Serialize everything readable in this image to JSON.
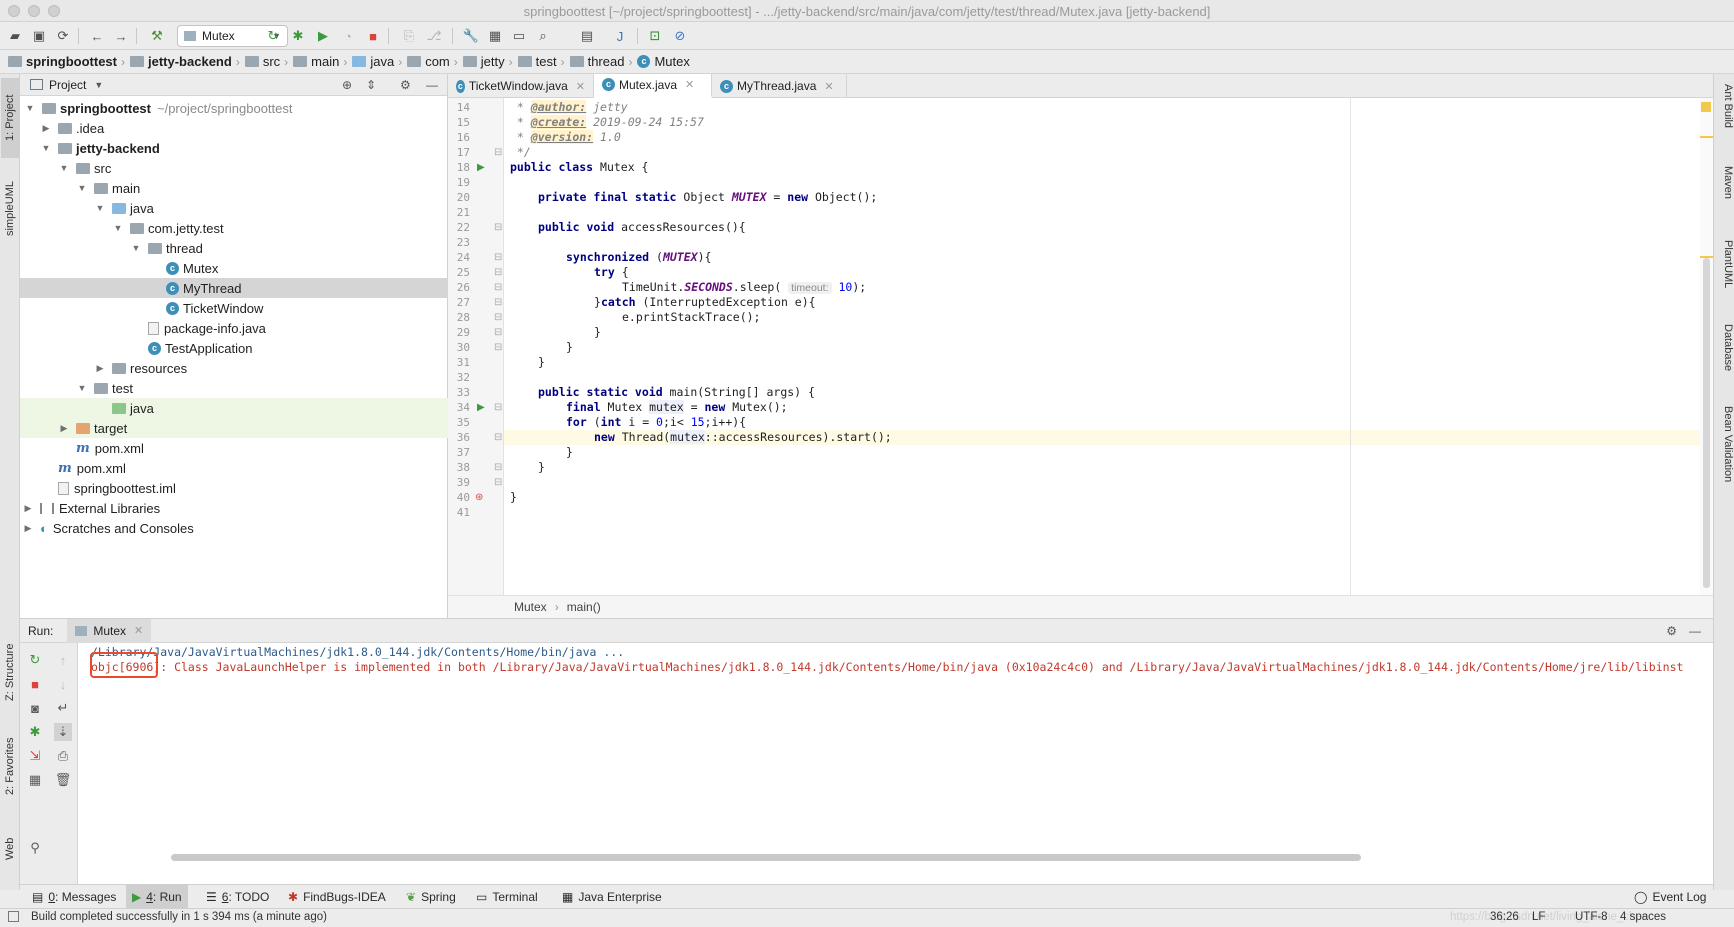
{
  "window": {
    "title": "springboottest [~/project/springboottest] - .../jetty-backend/src/main/java/com/jetty/test/thread/Mutex.java [jetty-backend]"
  },
  "toolbar": {
    "run_config": "Mutex"
  },
  "breadcrumbs": [
    "springboottest",
    "jetty-backend",
    "src",
    "main",
    "java",
    "com",
    "jetty",
    "test",
    "thread",
    "Mutex"
  ],
  "left_strip": {
    "tabs": [
      "1: Project",
      "simpleUML",
      "Z: Structure",
      "2: Favorites",
      "Web"
    ]
  },
  "right_strip": {
    "tabs": [
      "Ant Build",
      "Maven",
      "PlantUML",
      "Database",
      "Bean Validation"
    ]
  },
  "project": {
    "header": "Project",
    "tree": [
      {
        "label": "springboottest",
        "extra": "~/project/springboottest",
        "bold": true
      },
      {
        "label": ".idea"
      },
      {
        "label": "jetty-backend",
        "bold": true
      },
      {
        "label": "src"
      },
      {
        "label": "main"
      },
      {
        "label": "java"
      },
      {
        "label": "com.jetty.test"
      },
      {
        "label": "thread"
      },
      {
        "label": "Mutex"
      },
      {
        "label": "MyThread"
      },
      {
        "label": "TicketWindow"
      },
      {
        "label": "package-info.java"
      },
      {
        "label": "TestApplication"
      },
      {
        "label": "resources"
      },
      {
        "label": "test"
      },
      {
        "label": "java"
      },
      {
        "label": "target"
      },
      {
        "label": "pom.xml"
      },
      {
        "label": "pom.xml"
      },
      {
        "label": "springboottest.iml"
      },
      {
        "label": "External Libraries"
      },
      {
        "label": "Scratches and Consoles"
      }
    ]
  },
  "editor": {
    "tabs": [
      "TicketWindow.java",
      "Mutex.java",
      "MyThread.java"
    ],
    "active_tab": "Mutex.java",
    "line_numbers": [
      "14",
      "15",
      "16",
      "17",
      "18",
      "19",
      "20",
      "21",
      "22",
      "23",
      "24",
      "25",
      "26",
      "27",
      "28",
      "29",
      "30",
      "31",
      "32",
      "33",
      "34",
      "35",
      "36",
      "37",
      "38",
      "39",
      "40",
      "41"
    ],
    "code": {
      "l14_tag": "@author:",
      "l14_val": " jetty",
      "l15_tag": "@create:",
      "l15_val": " 2019-09-24 15:57",
      "l16_tag": "@version:",
      "l16_val": " 1.0",
      "l17": " */",
      "l18_kw": "public class",
      "l18_rest": " Mutex {",
      "l20_kw": "private final static",
      "l20_a": " Object ",
      "l20_st": "MUTEX",
      "l20_b": " = ",
      "l20_kw2": "new",
      "l20_c": " Object();",
      "l22_kw": "public void",
      "l22_rest": " accessResources(){",
      "l24_kw": "synchronized",
      "l24_a": " (",
      "l24_st": "MUTEX",
      "l24_b": "){",
      "l25_kw": "try",
      "l25_rest": " {",
      "l26_a": "TimeUnit.",
      "l26_st": "SECONDS",
      "l26_b": ".sleep( ",
      "l26_hint": "timeout:",
      "l26_num": "10",
      "l26_c": ");",
      "l27_a": "}",
      "l27_kw": "catch",
      "l27_b": " (InterruptedException e){",
      "l28": "e.printStackTrace();",
      "l29": "}",
      "l30": "}",
      "l31": "}",
      "l33_kw": "public static void",
      "l33_rest": " main(String[] args) {",
      "l34_kw": "final",
      "l34_a": " Mutex ",
      "l34_ref": "mutex",
      "l34_b": " = ",
      "l34_kw2": "new",
      "l34_c": " Mutex();",
      "l35_kw": "for",
      "l35_a": " (",
      "l35_kw2": "int",
      "l35_b": " i = ",
      "l35_num": "0",
      "l35_c": ";i< ",
      "l35_num2": "15",
      "l35_d": ";i++){",
      "l36_kw": "new",
      "l36_a": " Thread(",
      "l36_ref": "mutex",
      "l36_b": "::accessResources).start();",
      "l37": "}",
      "l38": "}",
      "l40": "}"
    },
    "crumbs": [
      "Mutex",
      "main()"
    ]
  },
  "run_panel": {
    "label": "Run:",
    "tab": "Mutex",
    "console_lines": [
      "/Library/Java/JavaVirtualMachines/jdk1.8.0_144.jdk/Contents/Home/bin/java ...",
      "objc[6906]: Class JavaLaunchHelper is implemented in both /Library/Java/JavaVirtualMachines/jdk1.8.0_144.jdk/Contents/Home/bin/java (0x10a24c4c0) and /Library/Java/JavaVirtualMachines/jdk1.8.0_144.jdk/Contents/Home/jre/lib/libinst"
    ]
  },
  "bottom_tabs": {
    "messages": {
      "key": "0",
      "label": ": Messages"
    },
    "run": {
      "key": "4",
      "label": ": Run"
    },
    "todo": {
      "key": "6",
      "label": ": TODO"
    },
    "findbugs": "FindBugs-IDEA",
    "spring": "Spring",
    "terminal": "Terminal",
    "java_enterprise": "Java Enterprise",
    "event_log": "Event Log"
  },
  "status": {
    "message": "Build completed successfully in 1 s 394 ms (a minute ago)",
    "position": "36:26",
    "line_sep": "LF",
    "encoding": "UTF-8",
    "indent": "4 spaces",
    "watermark": "https://blog.csdn.net/living_alone_chen"
  },
  "colors": {
    "keyword": "#000080",
    "static_field": "#660e7a",
    "number": "#0000ff",
    "console_error": "#c0392b",
    "highlight_box": "#e84a2a"
  }
}
